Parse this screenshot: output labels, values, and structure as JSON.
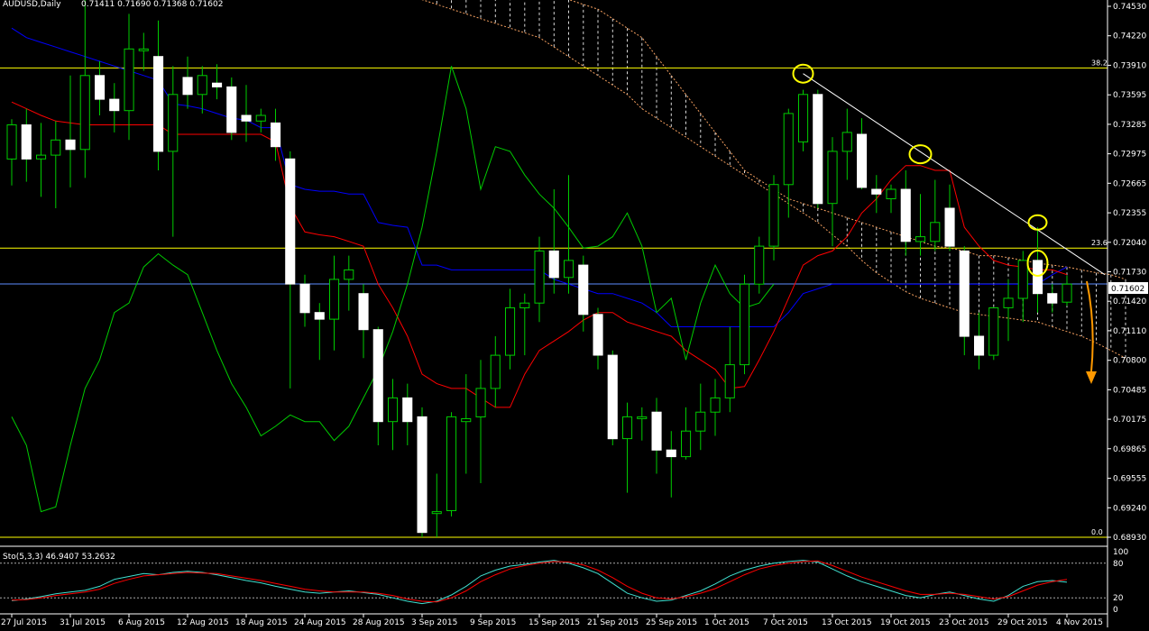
{
  "header": {
    "symbol": "AUDUSD,Daily",
    "ohlc": "0.71411 0.71690 0.71368 0.71602"
  },
  "stochastic": {
    "label": "Sto(5,3,3) 46.9407 53.2632",
    "levels": [
      80,
      20
    ],
    "scale_labels": [
      "100",
      "80",
      "20",
      "0"
    ]
  },
  "current_price_label": "0.71602",
  "price_axis": {
    "ticks": [
      "0.74530",
      "0.74220",
      "0.73910",
      "0.73595",
      "0.73285",
      "0.72975",
      "0.72665",
      "0.72355",
      "0.72040",
      "0.71730",
      "0.71420",
      "0.71110",
      "0.70800",
      "0.70485",
      "0.70175",
      "0.69865",
      "0.69555",
      "0.69240",
      "0.68930"
    ]
  },
  "fib": {
    "levels": [
      {
        "label": "38.2",
        "price": 0.7388
      },
      {
        "label": "23.6",
        "price": 0.7198
      },
      {
        "label": "0.0",
        "price": 0.6893
      }
    ]
  },
  "time_axis": {
    "labels": [
      "27 Jul 2015",
      "31 Jul 2015",
      "6 Aug 2015",
      "12 Aug 2015",
      "18 Aug 2015",
      "24 Aug 2015",
      "28 Aug 2015",
      "3 Sep 2015",
      "9 Sep 2015",
      "15 Sep 2015",
      "21 Sep 2015",
      "25 Sep 2015",
      "1 Oct 2015",
      "7 Oct 2015",
      "13 Oct 2015",
      "19 Oct 2015",
      "23 Oct 2015",
      "29 Oct 2015",
      "4 Nov 2015"
    ]
  },
  "colors": {
    "bull": "#000000",
    "bear": "#ffffff",
    "wick": "#00cc00",
    "tenkan": "#ff0000",
    "kijun": "#0000ff",
    "chikou": "#00cc00",
    "cloud": "#ffffff",
    "span_edge": "#f5a060",
    "fib": "#ffff00",
    "price_line": "#5b8cff",
    "trendline": "#ffffff",
    "marker": "#ffff00",
    "arrow": "#ff9900",
    "sto_main": "#40e0d0",
    "sto_signal": "#ff0000"
  },
  "chart_data": {
    "type": "candlestick",
    "title": "AUDUSD,Daily",
    "ylim": [
      0.6893,
      0.7453
    ],
    "candles": [
      {
        "x": "27 Jul 2015",
        "o": 0.7292,
        "h": 0.7334,
        "l": 0.7264,
        "c": 0.7328
      },
      {
        "x": "28 Jul 2015",
        "o": 0.7328,
        "h": 0.7345,
        "l": 0.7268,
        "c": 0.7292
      },
      {
        "x": "29 Jul 2015",
        "o": 0.7292,
        "h": 0.733,
        "l": 0.7252,
        "c": 0.7296
      },
      {
        "x": "30 Jul 2015",
        "o": 0.7296,
        "h": 0.7332,
        "l": 0.724,
        "c": 0.7312
      },
      {
        "x": "31 Jul 2015",
        "o": 0.7312,
        "h": 0.738,
        "l": 0.7262,
        "c": 0.7302
      },
      {
        "x": "3 Aug 2015",
        "o": 0.7302,
        "h": 0.746,
        "l": 0.7272,
        "c": 0.738
      },
      {
        "x": "4 Aug 2015",
        "o": 0.738,
        "h": 0.7395,
        "l": 0.7338,
        "c": 0.7355
      },
      {
        "x": "5 Aug 2015",
        "o": 0.7355,
        "h": 0.7372,
        "l": 0.732,
        "c": 0.7343
      },
      {
        "x": "6 Aug 2015",
        "o": 0.7343,
        "h": 0.7445,
        "l": 0.7312,
        "c": 0.7408
      },
      {
        "x": "7 Aug 2015",
        "o": 0.7408,
        "h": 0.7425,
        "l": 0.7385,
        "c": 0.7408
      },
      {
        "x": "10 Aug 2015",
        "o": 0.74,
        "h": 0.7438,
        "l": 0.728,
        "c": 0.73
      },
      {
        "x": "11 Aug 2015",
        "o": 0.73,
        "h": 0.739,
        "l": 0.721,
        "c": 0.736
      },
      {
        "x": "12 Aug 2015",
        "o": 0.7378,
        "h": 0.74,
        "l": 0.7345,
        "c": 0.736
      },
      {
        "x": "13 Aug 2015",
        "o": 0.736,
        "h": 0.739,
        "l": 0.734,
        "c": 0.738
      },
      {
        "x": "14 Aug 2015",
        "o": 0.7372,
        "h": 0.7392,
        "l": 0.7355,
        "c": 0.7368
      },
      {
        "x": "17 Aug 2015",
        "o": 0.7368,
        "h": 0.7378,
        "l": 0.7312,
        "c": 0.732
      },
      {
        "x": "18 Aug 2015",
        "o": 0.7338,
        "h": 0.737,
        "l": 0.731,
        "c": 0.7332
      },
      {
        "x": "19 Aug 2015",
        "o": 0.7332,
        "h": 0.7345,
        "l": 0.732,
        "c": 0.7338
      },
      {
        "x": "20 Aug 2015",
        "o": 0.733,
        "h": 0.7345,
        "l": 0.729,
        "c": 0.7305
      },
      {
        "x": "21 Aug 2015",
        "o": 0.7292,
        "h": 0.73,
        "l": 0.705,
        "c": 0.716
      },
      {
        "x": "24 Aug 2015",
        "o": 0.716,
        "h": 0.717,
        "l": 0.7115,
        "c": 0.713
      },
      {
        "x": "25 Aug 2015",
        "o": 0.713,
        "h": 0.714,
        "l": 0.708,
        "c": 0.7123
      },
      {
        "x": "26 Aug 2015",
        "o": 0.7123,
        "h": 0.719,
        "l": 0.709,
        "c": 0.7165
      },
      {
        "x": "27 Aug 2015",
        "o": 0.7165,
        "h": 0.719,
        "l": 0.7132,
        "c": 0.7175
      },
      {
        "x": "28 Aug 2015",
        "o": 0.715,
        "h": 0.716,
        "l": 0.7082,
        "c": 0.7112
      },
      {
        "x": "31 Aug 2015",
        "o": 0.7112,
        "h": 0.7115,
        "l": 0.699,
        "c": 0.7015
      },
      {
        "x": "1 Sep 2015",
        "o": 0.7015,
        "h": 0.706,
        "l": 0.6985,
        "c": 0.704
      },
      {
        "x": "2 Sep 2015",
        "o": 0.704,
        "h": 0.7055,
        "l": 0.699,
        "c": 0.7015
      },
      {
        "x": "3 Sep 2015",
        "o": 0.702,
        "h": 0.703,
        "l": 0.6893,
        "c": 0.6898
      },
      {
        "x": "4 Sep 2015",
        "o": 0.6918,
        "h": 0.696,
        "l": 0.6893,
        "c": 0.692
      },
      {
        "x": "7 Sep 2015",
        "o": 0.6921,
        "h": 0.7025,
        "l": 0.6915,
        "c": 0.702
      },
      {
        "x": "8 Sep 2015",
        "o": 0.7015,
        "h": 0.7065,
        "l": 0.696,
        "c": 0.7018
      },
      {
        "x": "9 Sep 2015",
        "o": 0.702,
        "h": 0.708,
        "l": 0.695,
        "c": 0.705
      },
      {
        "x": "10 Sep 2015",
        "o": 0.705,
        "h": 0.7105,
        "l": 0.703,
        "c": 0.7085
      },
      {
        "x": "11 Sep 2015",
        "o": 0.7085,
        "h": 0.7155,
        "l": 0.707,
        "c": 0.7135
      },
      {
        "x": "14 Sep 2015",
        "o": 0.7135,
        "h": 0.715,
        "l": 0.7085,
        "c": 0.714
      },
      {
        "x": "15 Sep 2015",
        "o": 0.714,
        "h": 0.721,
        "l": 0.712,
        "c": 0.7195
      },
      {
        "x": "16 Sep 2015",
        "o": 0.7195,
        "h": 0.726,
        "l": 0.715,
        "c": 0.7167
      },
      {
        "x": "17 Sep 2015",
        "o": 0.7167,
        "h": 0.7275,
        "l": 0.715,
        "c": 0.7185
      },
      {
        "x": "18 Sep 2015",
        "o": 0.718,
        "h": 0.719,
        "l": 0.711,
        "c": 0.7128
      },
      {
        "x": "21 Sep 2015",
        "o": 0.7128,
        "h": 0.7135,
        "l": 0.707,
        "c": 0.7085
      },
      {
        "x": "22 Sep 2015",
        "o": 0.7085,
        "h": 0.709,
        "l": 0.699,
        "c": 0.6997
      },
      {
        "x": "23 Sep 2015",
        "o": 0.6997,
        "h": 0.7035,
        "l": 0.694,
        "c": 0.702
      },
      {
        "x": "24 Sep 2015",
        "o": 0.702,
        "h": 0.703,
        "l": 0.6995,
        "c": 0.702
      },
      {
        "x": "25 Sep 2015",
        "o": 0.7025,
        "h": 0.704,
        "l": 0.696,
        "c": 0.6985
      },
      {
        "x": "28 Sep 2015",
        "o": 0.6985,
        "h": 0.7005,
        "l": 0.6935,
        "c": 0.6978
      },
      {
        "x": "29 Sep 2015",
        "o": 0.6978,
        "h": 0.703,
        "l": 0.6975,
        "c": 0.7005
      },
      {
        "x": "30 Sep 2015",
        "o": 0.7005,
        "h": 0.7055,
        "l": 0.6985,
        "c": 0.7025
      },
      {
        "x": "1 Oct 2015",
        "o": 0.7025,
        "h": 0.706,
        "l": 0.7,
        "c": 0.704
      },
      {
        "x": "2 Oct 2015",
        "o": 0.704,
        "h": 0.7115,
        "l": 0.7025,
        "c": 0.7075
      },
      {
        "x": "5 Oct 2015",
        "o": 0.7075,
        "h": 0.717,
        "l": 0.7065,
        "c": 0.716
      },
      {
        "x": "6 Oct 2015",
        "o": 0.716,
        "h": 0.721,
        "l": 0.715,
        "c": 0.72
      },
      {
        "x": "7 Oct 2015",
        "o": 0.72,
        "h": 0.7275,
        "l": 0.7185,
        "c": 0.7265
      },
      {
        "x": "8 Oct 2015",
        "o": 0.7265,
        "h": 0.7345,
        "l": 0.723,
        "c": 0.734
      },
      {
        "x": "9 Oct 2015",
        "o": 0.731,
        "h": 0.7365,
        "l": 0.73,
        "c": 0.736
      },
      {
        "x": "12 Oct 2015",
        "o": 0.736,
        "h": 0.7365,
        "l": 0.724,
        "c": 0.7245
      },
      {
        "x": "13 Oct 2015",
        "o": 0.7245,
        "h": 0.7315,
        "l": 0.72,
        "c": 0.73
      },
      {
        "x": "14 Oct 2015",
        "o": 0.73,
        "h": 0.7345,
        "l": 0.727,
        "c": 0.732
      },
      {
        "x": "15 Oct 2015",
        "o": 0.7318,
        "h": 0.7335,
        "l": 0.726,
        "c": 0.7262
      },
      {
        "x": "16 Oct 2015",
        "o": 0.726,
        "h": 0.7275,
        "l": 0.7235,
        "c": 0.7255
      },
      {
        "x": "19 Oct 2015",
        "o": 0.725,
        "h": 0.7265,
        "l": 0.7235,
        "c": 0.726
      },
      {
        "x": "20 Oct 2015",
        "o": 0.726,
        "h": 0.728,
        "l": 0.719,
        "c": 0.7205
      },
      {
        "x": "21 Oct 2015",
        "o": 0.7205,
        "h": 0.7255,
        "l": 0.719,
        "c": 0.721
      },
      {
        "x": "22 Oct 2015",
        "o": 0.7205,
        "h": 0.727,
        "l": 0.7195,
        "c": 0.7225
      },
      {
        "x": "23 Oct 2015",
        "o": 0.724,
        "h": 0.7265,
        "l": 0.7195,
        "c": 0.72
      },
      {
        "x": "26 Oct 2015",
        "o": 0.7195,
        "h": 0.72,
        "l": 0.7085,
        "c": 0.7105
      },
      {
        "x": "27 Oct 2015",
        "o": 0.7105,
        "h": 0.713,
        "l": 0.707,
        "c": 0.7085
      },
      {
        "x": "28 Oct 2015",
        "o": 0.7085,
        "h": 0.7135,
        "l": 0.708,
        "c": 0.7135
      },
      {
        "x": "29 Oct 2015",
        "o": 0.7135,
        "h": 0.7165,
        "l": 0.71,
        "c": 0.7145
      },
      {
        "x": "30 Oct 2015",
        "o": 0.7145,
        "h": 0.7195,
        "l": 0.712,
        "c": 0.7185
      },
      {
        "x": "2 Nov 2015",
        "o": 0.7185,
        "h": 0.722,
        "l": 0.713,
        "c": 0.715
      },
      {
        "x": "3 Nov 2015",
        "o": 0.715,
        "h": 0.716,
        "l": 0.713,
        "c": 0.714
      },
      {
        "x": "4 Nov 2015",
        "o": 0.7141,
        "h": 0.7169,
        "l": 0.7137,
        "c": 0.716
      }
    ],
    "tenkan": [
      0.7352,
      0.7345,
      0.7338,
      0.7332,
      0.733,
      0.7328,
      0.7328,
      0.7328,
      0.7328,
      0.7328,
      0.7328,
      0.7318,
      0.7318,
      0.7318,
      0.7318,
      0.7318,
      0.7318,
      0.7318,
      0.731,
      0.7242,
      0.7215,
      0.7212,
      0.721,
      0.7205,
      0.72,
      0.716,
      0.7135,
      0.7105,
      0.7065,
      0.7055,
      0.705,
      0.705,
      0.704,
      0.703,
      0.703,
      0.7065,
      0.709,
      0.71,
      0.711,
      0.7122,
      0.713,
      0.713,
      0.712,
      0.7115,
      0.711,
      0.7105,
      0.709,
      0.708,
      0.707,
      0.705,
      0.7052,
      0.708,
      0.711,
      0.7145,
      0.718,
      0.719,
      0.7195,
      0.721,
      0.7235,
      0.725,
      0.727,
      0.7285,
      0.7285,
      0.728,
      0.728,
      0.722,
      0.72,
      0.7185,
      0.718,
      0.7178,
      0.7175,
      0.7175,
      0.717
    ],
    "kijun": [
      0.743,
      0.742,
      0.7415,
      0.741,
      0.7405,
      0.74,
      0.7395,
      0.739,
      0.7385,
      0.738,
      0.7375,
      0.735,
      0.7348,
      0.7345,
      0.734,
      0.7335,
      0.7333,
      0.7325,
      0.7325,
      0.7265,
      0.726,
      0.7258,
      0.7258,
      0.7255,
      0.7255,
      0.7225,
      0.7222,
      0.722,
      0.718,
      0.718,
      0.7175,
      0.7175,
      0.7175,
      0.7175,
      0.7175,
      0.7175,
      0.7175,
      0.7165,
      0.716,
      0.7155,
      0.715,
      0.715,
      0.7145,
      0.714,
      0.713,
      0.7115,
      0.7115,
      0.7115,
      0.7115,
      0.7115,
      0.7115,
      0.7115,
      0.7115,
      0.713,
      0.715,
      0.7155,
      0.716,
      0.716,
      0.716,
      0.716,
      0.716,
      0.716,
      0.716,
      0.716,
      0.716,
      0.716,
      0.716,
      0.716,
      0.716,
      0.716,
      0.716,
      0.717,
      0.7178
    ]
  },
  "stoch_data": {
    "main": [
      15,
      18,
      22,
      27,
      30,
      33,
      40,
      52,
      57,
      62,
      60,
      64,
      66,
      64,
      60,
      55,
      50,
      46,
      40,
      35,
      30,
      28,
      30,
      32,
      29,
      26,
      20,
      14,
      10,
      14,
      25,
      40,
      58,
      68,
      75,
      78,
      82,
      85,
      80,
      72,
      62,
      45,
      28,
      20,
      14,
      16,
      24,
      32,
      44,
      58,
      68,
      75,
      80,
      83,
      85,
      82,
      70,
      58,
      48,
      40,
      32,
      24,
      20,
      26,
      30,
      24,
      18,
      14,
      24,
      40,
      48,
      50,
      47
    ],
    "signal": [
      16,
      17,
      20,
      24,
      27,
      30,
      35,
      45,
      52,
      58,
      60,
      62,
      64,
      63,
      62,
      58,
      54,
      50,
      45,
      40,
      35,
      32,
      30,
      30,
      30,
      28,
      24,
      18,
      14,
      13,
      20,
      32,
      48,
      60,
      70,
      76,
      80,
      83,
      82,
      77,
      68,
      55,
      40,
      28,
      20,
      18,
      22,
      28,
      36,
      48,
      60,
      70,
      76,
      80,
      83,
      84,
      76,
      66,
      56,
      48,
      40,
      32,
      26,
      26,
      28,
      26,
      22,
      18,
      22,
      32,
      42,
      48,
      52
    ]
  },
  "ichimoku_cloud": {
    "span_a": [
      0.748,
      0.7475,
      0.747,
      0.7465,
      0.746,
      0.7455,
      0.745,
      0.7445,
      0.744,
      0.7435,
      0.743,
      0.7425,
      0.742,
      0.741,
      0.74,
      0.739,
      0.738,
      0.737,
      0.736,
      0.7345,
      0.7335,
      0.7325,
      0.7315,
      0.7305,
      0.7295,
      0.7285,
      0.7275,
      0.7265,
      0.7255,
      0.7245,
      0.7235,
      0.7225,
      0.7212,
      0.72,
      0.7185,
      0.7172,
      0.7162,
      0.7152,
      0.7145,
      0.714,
      0.7135,
      0.713,
      0.7128,
      0.7126,
      0.7124,
      0.7122,
      0.712,
      0.7115,
      0.711,
      0.7105,
      0.7098,
      0.709,
      0.7082
    ],
    "span_b": [
      0.752,
      0.752,
      0.7518,
      0.7515,
      0.7512,
      0.751,
      0.7505,
      0.75,
      0.7495,
      0.749,
      0.7485,
      0.748,
      0.7475,
      0.747,
      0.746,
      0.7455,
      0.745,
      0.744,
      0.743,
      0.742,
      0.74,
      0.738,
      0.736,
      0.734,
      0.732,
      0.73,
      0.728,
      0.727,
      0.726,
      0.725,
      0.7245,
      0.724,
      0.7235,
      0.723,
      0.7225,
      0.722,
      0.7215,
      0.721,
      0.7205,
      0.72,
      0.7198,
      0.7195,
      0.719,
      0.719,
      0.7188,
      0.7185,
      0.7182,
      0.718,
      0.7178,
      0.7175,
      0.7172,
      0.717,
      0.7165
    ]
  },
  "chikou": [
    0.702,
    0.699,
    0.692,
    0.6925,
    0.699,
    0.705,
    0.708,
    0.713,
    0.714,
    0.7178,
    0.7192,
    0.718,
    0.717,
    0.713,
    0.709,
    0.7055,
    0.703,
    0.7,
    0.701,
    0.7022,
    0.7015,
    0.7015,
    0.6995,
    0.701,
    0.704,
    0.707,
    0.711,
    0.716,
    0.722,
    0.73,
    0.739,
    0.7345,
    0.726,
    0.7305,
    0.73,
    0.7275,
    0.7255,
    0.724,
    0.722,
    0.7198,
    0.72,
    0.721,
    0.7235,
    0.72,
    0.713,
    0.7145,
    0.708,
    0.714,
    0.718,
    0.715,
    0.7135,
    0.714,
    0.716
  ]
}
